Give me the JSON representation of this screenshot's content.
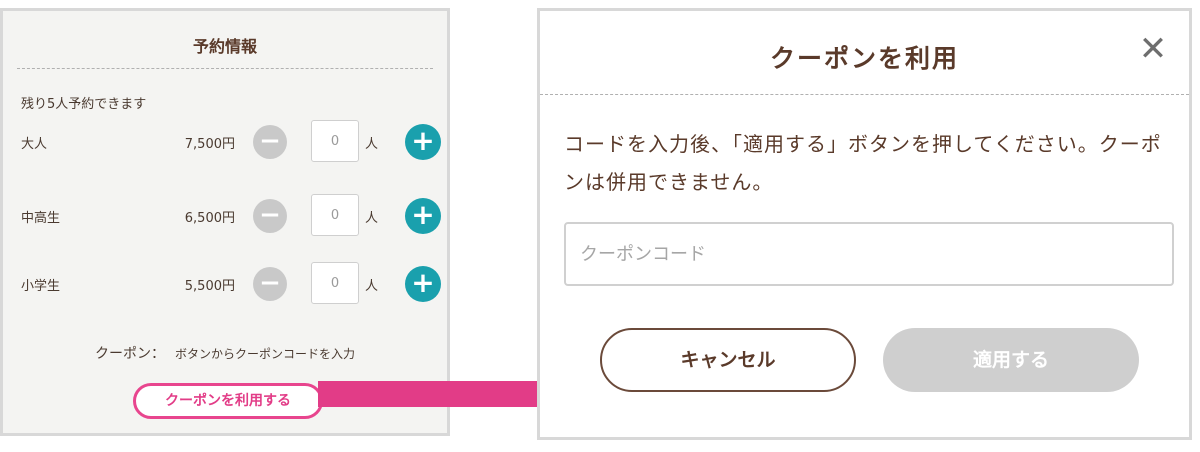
{
  "left": {
    "title": "予約情報",
    "remaining_text": "残り5人予約できます",
    "rows": [
      {
        "label": "大人",
        "price": "7,500円",
        "qty": "0",
        "unit": "人"
      },
      {
        "label": "中高生",
        "price": "6,500円",
        "qty": "0",
        "unit": "人"
      },
      {
        "label": "小学生",
        "price": "5,500円",
        "qty": "0",
        "unit": "人"
      }
    ],
    "minus_glyph": "−",
    "plus_glyph": "+",
    "coupon_label": "クーポン：",
    "coupon_value": "ボタンからクーポンコードを入力",
    "coupon_link": "クーポンを利用する"
  },
  "modal": {
    "title": "クーポンを利用",
    "close_glyph": "✕",
    "message": "コードを入力後、「適用する」ボタンを押してください。クーポンは併用できません。",
    "input_placeholder": "クーポンコード",
    "cancel_label": "キャンセル",
    "apply_label": "適用する"
  },
  "colors": {
    "accent_teal": "#1aa0ad",
    "highlight_pink": "#e23c87",
    "text_brown": "#5a3a2a",
    "disabled_gray": "#cfcfcf"
  },
  "icons": [
    "minus-circle-icon",
    "plus-circle-icon",
    "close-icon",
    "arrow-right-icon"
  ]
}
